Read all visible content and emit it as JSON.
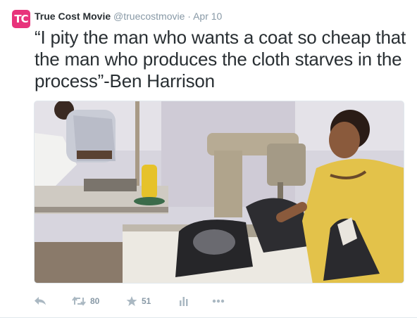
{
  "tweet": {
    "avatar_text": "TC",
    "author_name": "True Cost Movie",
    "handle": "@truecostmovie",
    "separator": "·",
    "time": "Apr 10",
    "text": "“I pity the man who wants a coat so cheap that the man who produces the cloth starves in the process”-Ben Harrison"
  },
  "actions": {
    "retweet_count": "80",
    "favorite_count": "51"
  },
  "colors": {
    "avatar_bg": "#e8337b",
    "text": "#292f33",
    "muted": "#8899a6",
    "icon": "#aab8c2"
  },
  "icons": [
    "reply-icon",
    "retweet-icon",
    "favorite-icon",
    "analytics-icon",
    "more-icon"
  ]
}
